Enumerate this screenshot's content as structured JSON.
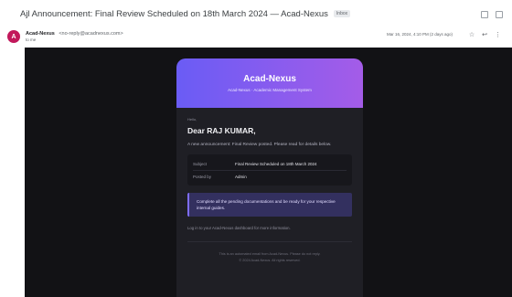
{
  "email": {
    "subject": "Ajl Announcement: Final Review Scheduled on 18th March 2024 — Acad-Nexus",
    "label_chip": "Inbox",
    "sender": {
      "initial": "A",
      "name": "Acad-Nexus",
      "email": "<no-reply@acadnexus.com>",
      "to": "to me",
      "date": "Mar 16, 2024, 4:10 PM (2 days ago)"
    },
    "actions": {
      "star": "☆",
      "reply": "↩",
      "more": "⋮"
    }
  },
  "card": {
    "brand": "Acad-Nexus",
    "brand_sub": "Acad-Nexus · Academic Management System",
    "small_label": "Hello,",
    "greeting": "Dear RAJ KUMAR,",
    "intro": "A new announcement: Final Review posted. Please read for details below.",
    "details": [
      {
        "key": "Subject",
        "value": "Final Review Scheduled on 18th March 2024"
      },
      {
        "key": "Posted by",
        "value": "Admin"
      }
    ],
    "callout": "Complete all the pending documentations and be ready for your respective internal guides.",
    "note": "Log in to your Acad-Nexus dashboard for more information.",
    "footer": [
      "This is an automated email from Acad-Nexus. Please do not reply.",
      "© 2024 Acad-Nexus. All rights reserved."
    ]
  }
}
